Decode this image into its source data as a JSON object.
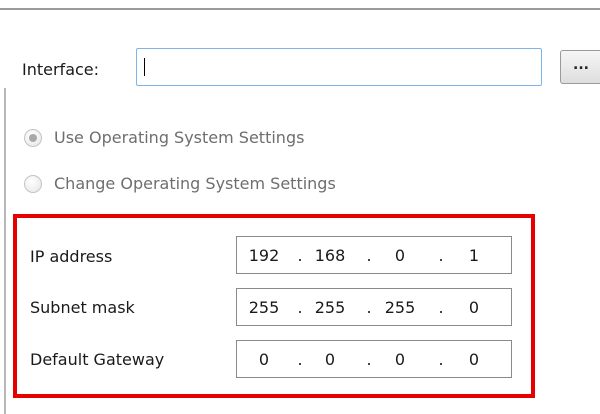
{
  "interface": {
    "label": "Interface:",
    "value": "",
    "browse_label": "..."
  },
  "os_settings": {
    "use_label": "Use Operating System Settings",
    "use_selected": true,
    "change_label": "Change Operating System Settings",
    "change_selected": false
  },
  "network": {
    "fields": [
      {
        "label": "IP address",
        "octets": [
          "192",
          "168",
          "0",
          "1"
        ]
      },
      {
        "label": "Subnet mask",
        "octets": [
          "255",
          "255",
          "255",
          "0"
        ]
      },
      {
        "label": "Default Gateway",
        "octets": [
          "0",
          "0",
          "0",
          "0"
        ]
      }
    ],
    "separator": ".",
    "highlight_color": "#e60000"
  }
}
